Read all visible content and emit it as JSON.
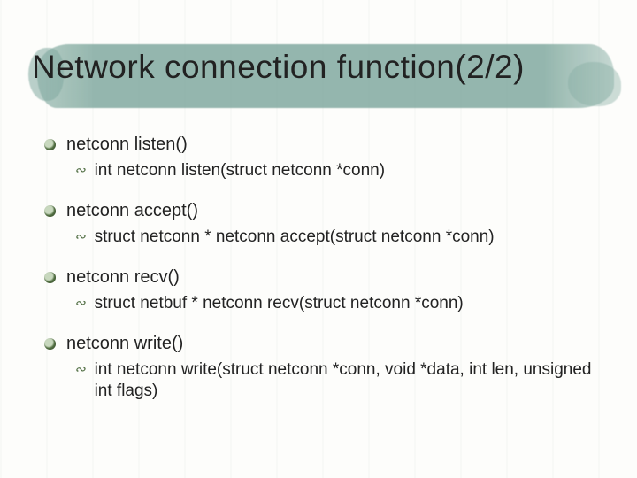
{
  "title": "Network connection function(2/2)",
  "items": [
    {
      "name": "netconn listen()",
      "sig": "int netconn listen(struct netconn *conn)"
    },
    {
      "name": "netconn accept()",
      "sig": "struct netconn * netconn accept(struct netconn *conn)"
    },
    {
      "name": "netconn recv()",
      "sig": "struct netbuf * netconn recv(struct netconn *conn)"
    },
    {
      "name": "netconn write()",
      "sig": "int netconn write(struct netconn *conn, void *data, int len, unsigned int flags)"
    }
  ]
}
